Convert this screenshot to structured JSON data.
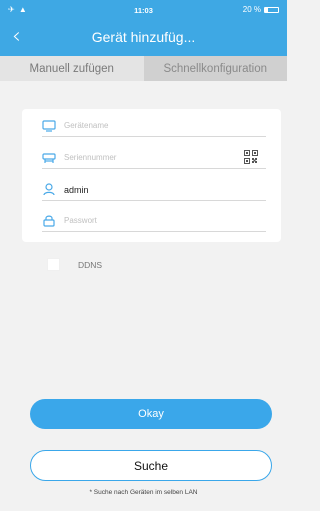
{
  "status_bar": {
    "left_icons": "✈ ▲",
    "time": "11:03",
    "battery_text": "20 %"
  },
  "nav": {
    "back_icon": "‹",
    "title": "Gerät hinzufüg..."
  },
  "tabs": [
    {
      "label": "Manuell zufügen"
    },
    {
      "label": "Schnellkonfiguration"
    }
  ],
  "form": {
    "device_name_placeholder": "Gerätename",
    "serial_placeholder": "Seriennummer",
    "username_value": "admin",
    "password_placeholder": "Passwort"
  },
  "ddns": {
    "label": "DDNS"
  },
  "buttons": {
    "okay_label": "Okay",
    "search_label": "Suche"
  },
  "hint": "* Suche nach Geräten im selben LAN",
  "colors": {
    "accent": "#3ea8e4",
    "button_blue": "#3aa7ea",
    "icon_blue": "#4aa9e8"
  }
}
